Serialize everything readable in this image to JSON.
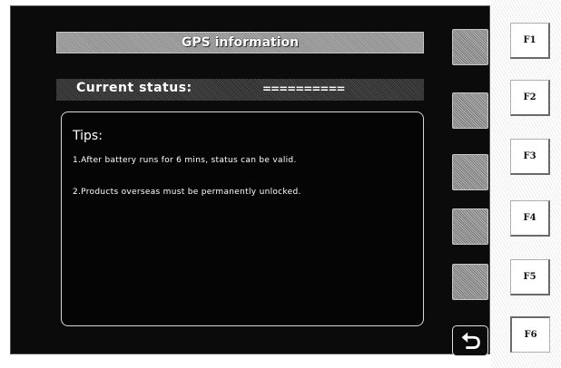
{
  "screen": {
    "title": "GPS information",
    "status_label": "Current status:",
    "status_value": "==========",
    "tips": {
      "heading": "Tips:",
      "items": [
        "1.After battery runs for 6 mins, status can be valid.",
        "2.Products overseas must be permanently unlocked."
      ]
    }
  },
  "side_buttons": {
    "back_icon": "return-arrow-icon"
  },
  "function_keys": [
    "F1",
    "F2",
    "F3",
    "F4",
    "F5",
    "F6"
  ],
  "colors": {
    "screen_background": "#0b0b0b",
    "text": "#ffffff",
    "header_bar": "#9a9a9a"
  }
}
